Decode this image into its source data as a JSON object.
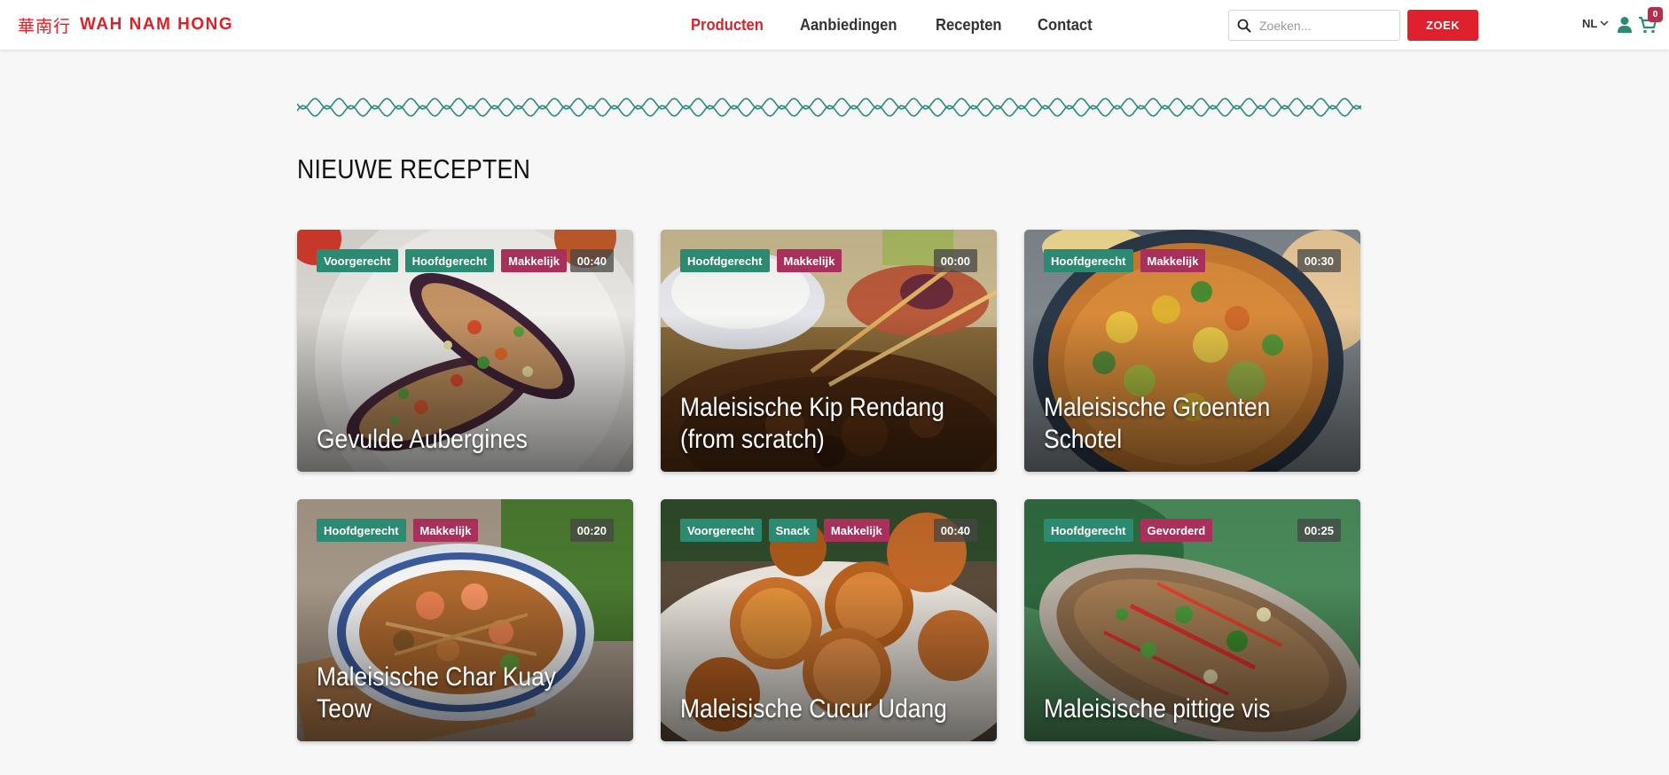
{
  "brand": {
    "hanzi": "華南行",
    "name": "WAH NAM HONG",
    "color": "#d8232a"
  },
  "nav": {
    "items": [
      {
        "label": "Producten",
        "active": true
      },
      {
        "label": "Aanbiedingen",
        "active": false
      },
      {
        "label": "Recepten",
        "active": false
      },
      {
        "label": "Contact",
        "active": false
      }
    ]
  },
  "search": {
    "placeholder": "Zoeken...",
    "button_label": "ZOEK",
    "icon": "search-icon"
  },
  "header_right": {
    "language": "NL",
    "user_icon": "user-icon",
    "cart_icon": "cart-icon",
    "cart_count": "0"
  },
  "section": {
    "title": "NIEUWE RECEPTEN"
  },
  "colors": {
    "tag_green": "#2a8a72",
    "tag_red": "#a8305a",
    "wave": "#2a8a80",
    "accent": "#e0202c"
  },
  "recipes": [
    {
      "title": "Gevulde Aubergines",
      "time": "00:40",
      "tags": [
        {
          "label": "Voorgerecht",
          "color": "green"
        },
        {
          "label": "Hoofdgerecht",
          "color": "green"
        },
        {
          "label": "Makkelijk",
          "color": "red"
        }
      ]
    },
    {
      "title": "Maleisische Kip Rendang (from scratch)",
      "time": "00:00",
      "tags": [
        {
          "label": "Hoofdgerecht",
          "color": "green"
        },
        {
          "label": "Makkelijk",
          "color": "red"
        }
      ]
    },
    {
      "title": "Maleisische Groenten Schotel",
      "time": "00:30",
      "tags": [
        {
          "label": "Hoofdgerecht",
          "color": "green"
        },
        {
          "label": "Makkelijk",
          "color": "red"
        }
      ]
    },
    {
      "title": "Maleisische Char Kuay Teow",
      "time": "00:20",
      "tags": [
        {
          "label": "Hoofdgerecht",
          "color": "green"
        },
        {
          "label": "Makkelijk",
          "color": "red"
        }
      ]
    },
    {
      "title": "Maleisische Cucur Udang",
      "time": "00:40",
      "tags": [
        {
          "label": "Voorgerecht",
          "color": "green"
        },
        {
          "label": "Snack",
          "color": "green"
        },
        {
          "label": "Makkelijk",
          "color": "red"
        }
      ]
    },
    {
      "title": "Maleisische pittige vis",
      "time": "00:25",
      "tags": [
        {
          "label": "Hoofdgerecht",
          "color": "green"
        },
        {
          "label": "Gevorderd",
          "color": "red"
        }
      ]
    }
  ]
}
